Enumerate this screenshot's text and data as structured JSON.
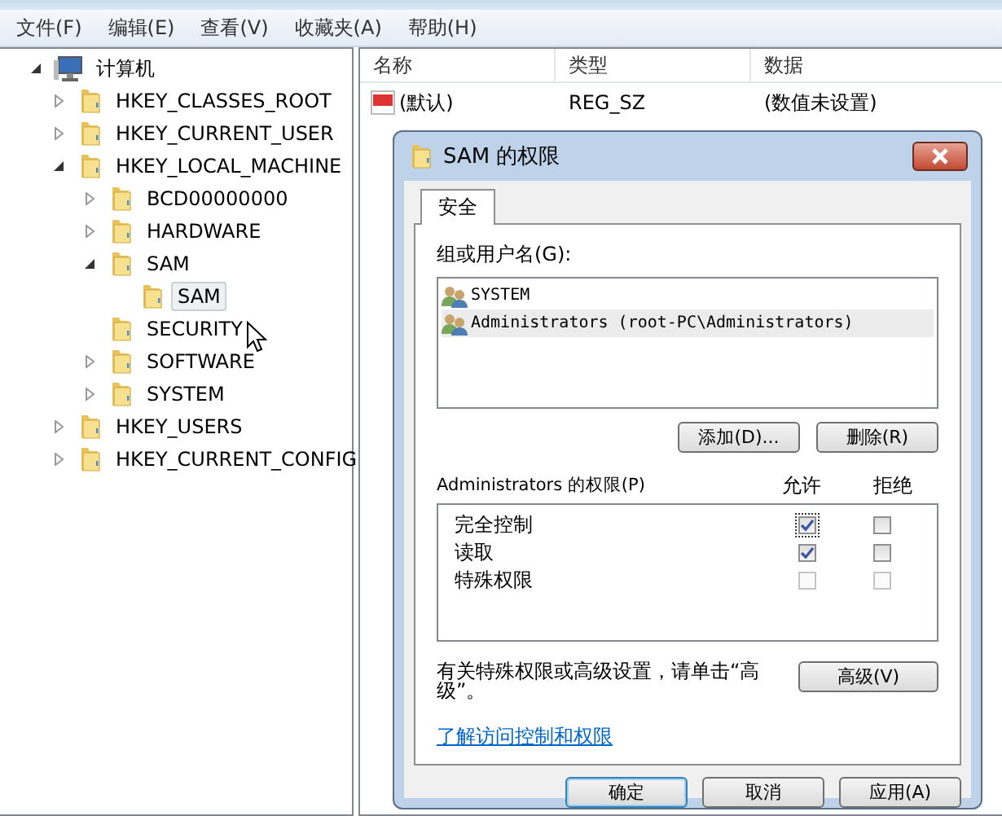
{
  "menu": [
    "文件(F)",
    "编辑(E)",
    "查看(V)",
    "收藏夹(A)",
    "帮助(H)"
  ],
  "tree": {
    "label": "计算机",
    "kind": "computer",
    "expanded": true,
    "selected": false,
    "children": [
      {
        "label": "HKEY_CLASSES_ROOT",
        "expanded": false,
        "selected": false
      },
      {
        "label": "HKEY_CURRENT_USER",
        "expanded": false,
        "selected": false
      },
      {
        "label": "HKEY_LOCAL_MACHINE",
        "expanded": true,
        "selected": false,
        "children": [
          {
            "label": "BCD00000000",
            "expanded": false,
            "selected": false
          },
          {
            "label": "HARDWARE",
            "expanded": false,
            "selected": false
          },
          {
            "label": "SAM",
            "expanded": true,
            "selected": false,
            "children": [
              {
                "label": "SAM",
                "selected": true
              }
            ]
          },
          {
            "label": "SECURITY",
            "selected": false
          },
          {
            "label": "SOFTWARE",
            "expanded": false,
            "selected": false
          },
          {
            "label": "SYSTEM",
            "expanded": false,
            "selected": false
          }
        ]
      },
      {
        "label": "HKEY_USERS",
        "expanded": false,
        "selected": false
      },
      {
        "label": "HKEY_CURRENT_CONFIG",
        "expanded": false,
        "selected": false
      }
    ]
  },
  "list": {
    "columns": [
      "名称",
      "类型",
      "数据"
    ],
    "rows": [
      {
        "name": "(默认)",
        "type": "REG_SZ",
        "data": "(数值未设置)"
      }
    ]
  },
  "dialog": {
    "title": "SAM 的权限",
    "tabs": [
      {
        "label": "安全",
        "selected": true
      }
    ],
    "groups_label": "组或用户名(G):",
    "users": [
      {
        "name": "SYSTEM",
        "selected": false
      },
      {
        "name": "Administrators (root-PC\\Administrators)",
        "selected": true
      }
    ],
    "add_button": "添加(D)...",
    "remove_button": "删除(R)",
    "perm_label": "Administrators 的权限(P)",
    "allow_header": "允许",
    "deny_header": "拒绝",
    "permissions": [
      {
        "name": "完全控制",
        "allow": {
          "checked": true,
          "greyed": true,
          "focused": true
        },
        "deny": {
          "checked": false,
          "greyed": true,
          "focused": false
        }
      },
      {
        "name": "读取",
        "allow": {
          "checked": true,
          "greyed": true,
          "focused": false
        },
        "deny": {
          "checked": false,
          "greyed": true,
          "focused": false
        }
      },
      {
        "name": "特殊权限",
        "allow": {
          "checked": false,
          "greyed": false,
          "focused": false
        },
        "deny": {
          "checked": false,
          "greyed": false,
          "focused": false
        }
      }
    ],
    "advanced_note": "有关特殊权限或高级设置，请单击“高级”。",
    "advanced_button": "高级(V)",
    "help_link": "了解访问控制和权限",
    "buttons": [
      {
        "label": "确定",
        "default": true
      },
      {
        "label": "取消",
        "default": false
      },
      {
        "label": "应用(A)",
        "default": false
      }
    ]
  }
}
